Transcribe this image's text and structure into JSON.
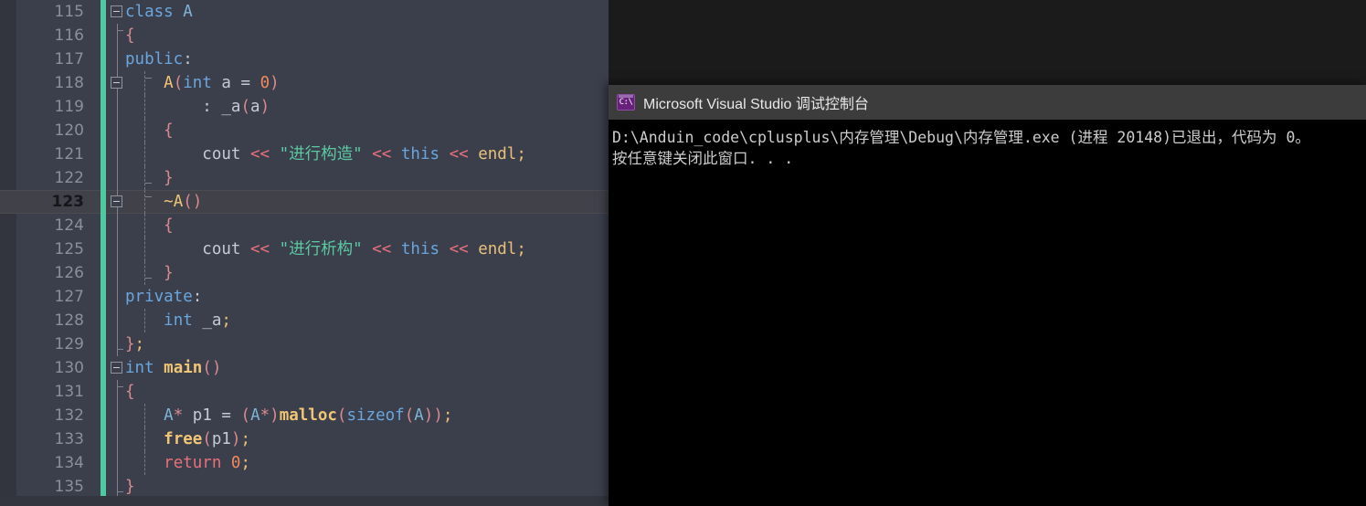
{
  "editor": {
    "language": "cpp",
    "current_line": 123,
    "theme_colors": {
      "background": "#3b3f4c",
      "gutter_text": "#8b8f99",
      "save_indicator": "#4ec9a0",
      "keyword": "#6aa6dd",
      "string": "#5bc9a2",
      "number": "#f08a5d",
      "function": "#f0c674",
      "operator": "#e8707a",
      "identifier": "#c5cad3"
    },
    "lines": [
      {
        "no": "115",
        "fold": true,
        "indent_guides": [],
        "text": "class A"
      },
      {
        "no": "116",
        "fold": false,
        "indent_guides": [
          "solid-start"
        ],
        "text": "{"
      },
      {
        "no": "117",
        "fold": false,
        "indent_guides": [
          "solid"
        ],
        "text": "public:"
      },
      {
        "no": "118",
        "fold": true,
        "indent_guides": [
          "solid",
          "dash-start"
        ],
        "text": "    A(int a = 0)"
      },
      {
        "no": "119",
        "fold": false,
        "indent_guides": [
          "solid",
          "dash"
        ],
        "text": "        : _a(a)"
      },
      {
        "no": "120",
        "fold": false,
        "indent_guides": [
          "solid",
          "dash"
        ],
        "text": "    {"
      },
      {
        "no": "121",
        "fold": false,
        "indent_guides": [
          "solid",
          "dash"
        ],
        "text": "        cout << \"进行构造\" << this << endl;"
      },
      {
        "no": "122",
        "fold": false,
        "indent_guides": [
          "solid",
          "dash-end"
        ],
        "text": "    }"
      },
      {
        "no": "123",
        "fold": true,
        "indent_guides": [
          "solid",
          "dash-start"
        ],
        "text": "    ~A()"
      },
      {
        "no": "124",
        "fold": false,
        "indent_guides": [
          "solid",
          "dash"
        ],
        "text": "    {"
      },
      {
        "no": "125",
        "fold": false,
        "indent_guides": [
          "solid",
          "dash"
        ],
        "text": "        cout << \"进行析构\" << this << endl;"
      },
      {
        "no": "126",
        "fold": false,
        "indent_guides": [
          "solid",
          "dash-end"
        ],
        "text": "    }"
      },
      {
        "no": "127",
        "fold": false,
        "indent_guides": [
          "solid"
        ],
        "text": "private:"
      },
      {
        "no": "128",
        "fold": false,
        "indent_guides": [
          "solid",
          "dash"
        ],
        "text": "    int _a;"
      },
      {
        "no": "129",
        "fold": false,
        "indent_guides": [
          "solid-end"
        ],
        "text": "};"
      },
      {
        "no": "130",
        "fold": true,
        "indent_guides": [],
        "text": "int main()"
      },
      {
        "no": "131",
        "fold": false,
        "indent_guides": [
          "solid-start"
        ],
        "text": "{"
      },
      {
        "no": "132",
        "fold": false,
        "indent_guides": [
          "solid",
          "dash"
        ],
        "text": "    A* p1 = (A*)malloc(sizeof(A));"
      },
      {
        "no": "133",
        "fold": false,
        "indent_guides": [
          "solid",
          "dash"
        ],
        "text": "    free(p1);"
      },
      {
        "no": "134",
        "fold": false,
        "indent_guides": [
          "solid",
          "dash"
        ],
        "text": "    return 0;"
      },
      {
        "no": "135",
        "fold": false,
        "indent_guides": [
          "solid-end"
        ],
        "text": "}"
      }
    ]
  },
  "console": {
    "title": "Microsoft Visual Studio 调试控制台",
    "icon": "console-cmd-icon",
    "background": "#000000",
    "titlebar_background": "#3c3c3c",
    "output_lines": [
      "D:\\Anduin_code\\cplusplus\\内存管理\\Debug\\内存管理.exe (进程 20148)已退出，代码为 0。",
      "按任意键关闭此窗口. . ."
    ]
  }
}
